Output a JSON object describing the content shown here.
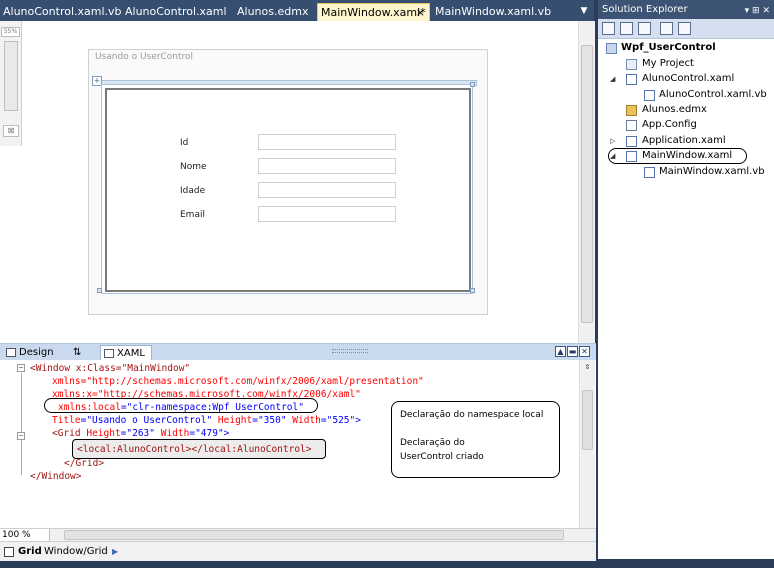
{
  "tabs": [
    {
      "label": "AlunoControl.xaml.vb",
      "active": false
    },
    {
      "label": "AlunoControl.xaml",
      "active": false
    },
    {
      "label": "Alunos.edmx",
      "active": false
    },
    {
      "label": "MainWindow.xaml*",
      "active": true
    },
    {
      "label": "MainWindow.xaml.vb",
      "active": false
    }
  ],
  "tab_close_glyph": "×",
  "tab_menu_glyph": "▼",
  "designer": {
    "zoom_slider_label": "55%",
    "window_title": "Usando o UserControl",
    "form": {
      "labels": [
        "Id",
        "Nome",
        "Idade",
        "Email"
      ]
    }
  },
  "split": {
    "design_tab": "Design",
    "swap_glyph": "⇅",
    "xaml_tab": "XAML",
    "btn_expand": "▲",
    "btn_horizontal": "▬",
    "btn_vertical": "▮",
    "btn_collapse": "✕"
  },
  "xaml": {
    "fold1": "−",
    "fold2": "−",
    "line1_open": "<Window x:Class=\"MainWindow\"",
    "line2": "xmlns=\"http://schemas.microsoft.com/winfx/2006/xaml/presentation\"",
    "line3": "xmlns:x=\"http://schemas.microsoft.com/winfx/2006/xaml\"",
    "line4_attr": "xmlns:local",
    "line4_val": "=\"clr-namespace:Wpf_UserControl\"",
    "line5_attr1": "Title",
    "line5_val1": "=\"Usando o UserControl\"",
    "line5_attr2": "Height",
    "line5_val2": "=\"350\"",
    "line5_attr3": "Width",
    "line5_val3": "=\"525\">",
    "line6_el": "<Grid",
    "line6_attr1": "Height",
    "line6_val1": "=\"263\"",
    "line6_attr2": "Width",
    "line6_val2": "=\"479\">",
    "line7": "<local:AlunoControl></local:AlunoControl>",
    "line8": "</Grid>",
    "line9": "</Window>",
    "annotation_1": "Declaração do namespace local",
    "annotation_2": "Declaração do UserControl criado",
    "split_button_glyph": "⇕"
  },
  "bottom_zoom": "100 %",
  "breadcrumb": {
    "root": "Grid",
    "path": "Window/Grid",
    "arrow": "▶"
  },
  "solution_explorer": {
    "title": "Solution Explorer",
    "title_buttons": "▾ ⊞ ✕",
    "items": [
      {
        "label": "Wpf_UserControl",
        "bold": true
      },
      {
        "label": "My Project"
      },
      {
        "label": "AlunoControl.xaml",
        "toggle": "◢"
      },
      {
        "label": "AlunoControl.xaml.vb"
      },
      {
        "label": "Alunos.edmx"
      },
      {
        "label": "App.Config"
      },
      {
        "label": "Application.xaml",
        "toggle": "▷"
      },
      {
        "label": "MainWindow.xaml",
        "toggle": "◢"
      },
      {
        "label": "MainWindow.xaml.vb"
      }
    ]
  },
  "colors": {
    "ide_background": "#2b3c59",
    "active_tab": "#fff5cc",
    "xaml_element": "#a31515",
    "xaml_attribute": "#ff0000",
    "xaml_value": "#0000ff"
  }
}
